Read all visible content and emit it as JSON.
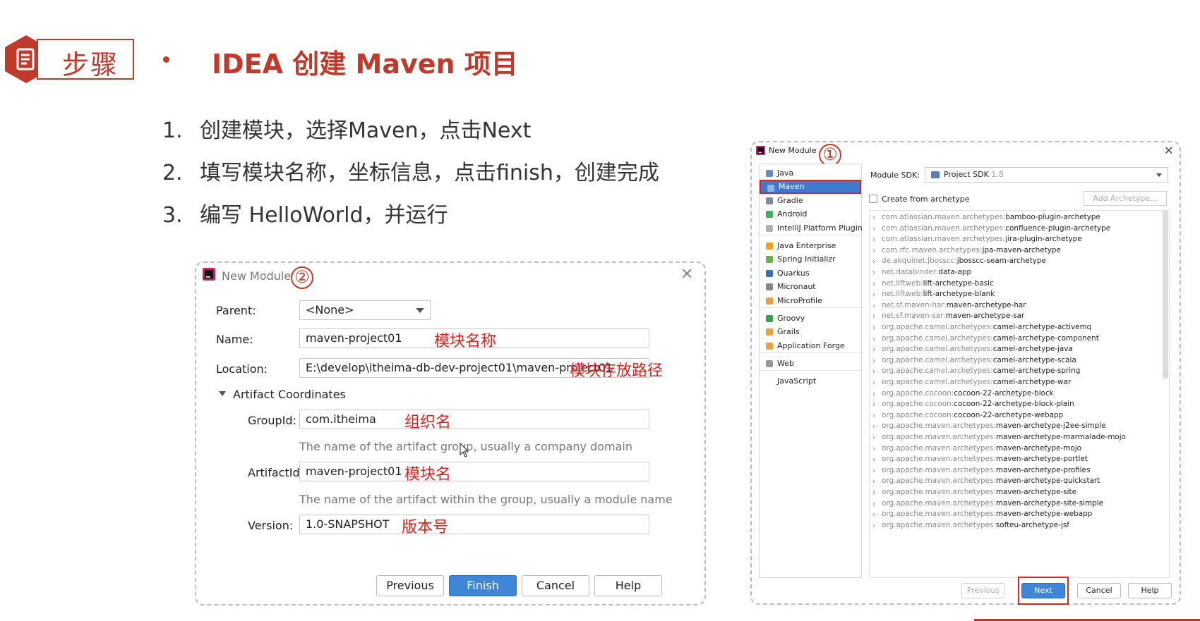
{
  "header": {
    "badge_icon": "document-icon",
    "badge_label": "步骤",
    "title": "IDEA 创建 Maven 项目",
    "accent_color": "#c0392b"
  },
  "steps": [
    {
      "num": "1.",
      "text": "创建模块，选择Maven，点击Next"
    },
    {
      "num": "2.",
      "text": "填写模块名称，坐标信息，点击finish，创建完成"
    },
    {
      "num": "3.",
      "text": "编写 HelloWorld，并运行"
    }
  ],
  "dialog2": {
    "title": "New Module",
    "marker": "②",
    "parent_label": "Parent:",
    "parent_value": "<None>",
    "name_label": "Name:",
    "name_value": "maven-project01",
    "name_note": "模块名称",
    "location_label": "Location:",
    "location_value": "E:\\develop\\itheima-db-dev-project01\\maven-project01",
    "location_note": "模块存放路径",
    "section_label": "Artifact Coordinates",
    "groupid_label": "GroupId:",
    "groupid_value": "com.itheima",
    "groupid_note": "组织名",
    "groupid_hint": "The name of the artifact group, usually a company domain",
    "artifactid_label": "ArtifactId:",
    "artifactid_value": "maven-project01",
    "artifactid_note": "模块名",
    "artifactid_hint": "The name of the artifact within the group, usually a module name",
    "version_label": "Version:",
    "version_value": "1.0-SNAPSHOT",
    "version_note": "版本号",
    "buttons": {
      "previous": "Previous",
      "finish": "Finish",
      "cancel": "Cancel",
      "help": "Help"
    }
  },
  "dialog1": {
    "title": "New Module",
    "marker": "①",
    "generators": [
      {
        "label": "Java",
        "color": "#6a8cb8"
      },
      {
        "label": "Maven",
        "color": "#8fb4e8",
        "selected": true
      },
      {
        "label": "Gradle",
        "color": "#7a8c99"
      },
      {
        "label": "Android",
        "color": "#3dae5a"
      },
      {
        "label": "IntelliJ Platform Plugin",
        "color": "#b0b0b0"
      },
      {
        "label": "Java Enterprise",
        "color": "#f0a020"
      },
      {
        "label": "Spring Initializr",
        "color": "#6ab04c"
      },
      {
        "label": "Quarkus",
        "color": "#3a6fb5"
      },
      {
        "label": "Micronaut",
        "color": "#888888"
      },
      {
        "label": "MicroProfile",
        "color": "#e8a040"
      },
      {
        "label": "Groovy",
        "color": "#3aa04a"
      },
      {
        "label": "Grails",
        "color": "#e8a040"
      },
      {
        "label": "Application Forge",
        "color": "#e8a040"
      },
      {
        "label": "Web",
        "color": "#999999"
      },
      {
        "label": "JavaScript",
        "color": "#ffffff"
      }
    ],
    "sdk_label": "Module SDK:",
    "sdk_value": "Project SDK",
    "sdk_version": "1.8",
    "archetype_checkbox": "Create from archetype",
    "add_archetype": "Add Archetype...",
    "archetypes": [
      {
        "group": "com.atlassian.maven.archetypes:",
        "artifact": "bamboo-plugin-archetype"
      },
      {
        "group": "com.atlassian.maven.archetypes:",
        "artifact": "confluence-plugin-archetype"
      },
      {
        "group": "com.atlassian.maven.archetypes:",
        "artifact": "jira-plugin-archetype"
      },
      {
        "group": "com.rfc.maven.archetypes:",
        "artifact": "jpa-maven-archetype"
      },
      {
        "group": "de.akquinet.jbosscc:",
        "artifact": "jbosscc-seam-archetype"
      },
      {
        "group": "net.databinder:",
        "artifact": "data-app"
      },
      {
        "group": "net.liftweb:",
        "artifact": "lift-archetype-basic"
      },
      {
        "group": "net.liftweb:",
        "artifact": "lift-archetype-blank"
      },
      {
        "group": "net.sf.maven-har:",
        "artifact": "maven-archetype-har"
      },
      {
        "group": "net.sf.maven-sar:",
        "artifact": "maven-archetype-sar"
      },
      {
        "group": "org.apache.camel.archetypes:",
        "artifact": "camel-archetype-activemq"
      },
      {
        "group": "org.apache.camel.archetypes:",
        "artifact": "camel-archetype-component"
      },
      {
        "group": "org.apache.camel.archetypes:",
        "artifact": "camel-archetype-java"
      },
      {
        "group": "org.apache.camel.archetypes:",
        "artifact": "camel-archetype-scala"
      },
      {
        "group": "org.apache.camel.archetypes:",
        "artifact": "camel-archetype-spring"
      },
      {
        "group": "org.apache.camel.archetypes:",
        "artifact": "camel-archetype-war"
      },
      {
        "group": "org.apache.cocoon:",
        "artifact": "cocoon-22-archetype-block"
      },
      {
        "group": "org.apache.cocoon:",
        "artifact": "cocoon-22-archetype-block-plain"
      },
      {
        "group": "org.apache.cocoon:",
        "artifact": "cocoon-22-archetype-webapp"
      },
      {
        "group": "org.apache.maven.archetypes:",
        "artifact": "maven-archetype-j2ee-simple"
      },
      {
        "group": "org.apache.maven.archetypes:",
        "artifact": "maven-archetype-marmalade-mojo"
      },
      {
        "group": "org.apache.maven.archetypes:",
        "artifact": "maven-archetype-mojo"
      },
      {
        "group": "org.apache.maven.archetypes:",
        "artifact": "maven-archetype-portlet"
      },
      {
        "group": "org.apache.maven.archetypes:",
        "artifact": "maven-archetype-profiles"
      },
      {
        "group": "org.apache.maven.archetypes:",
        "artifact": "maven-archetype-quickstart"
      },
      {
        "group": "org.apache.maven.archetypes:",
        "artifact": "maven-archetype-site"
      },
      {
        "group": "org.apache.maven.archetypes:",
        "artifact": "maven-archetype-site-simple"
      },
      {
        "group": "org.apache.maven.archetypes:",
        "artifact": "maven-archetype-webapp"
      },
      {
        "group": "org.apache.maven.archetypes:",
        "artifact": "softeu-archetype-jsf"
      }
    ],
    "buttons": {
      "previous": "Previous",
      "next": "Next",
      "cancel": "Cancel",
      "help": "Help"
    }
  }
}
